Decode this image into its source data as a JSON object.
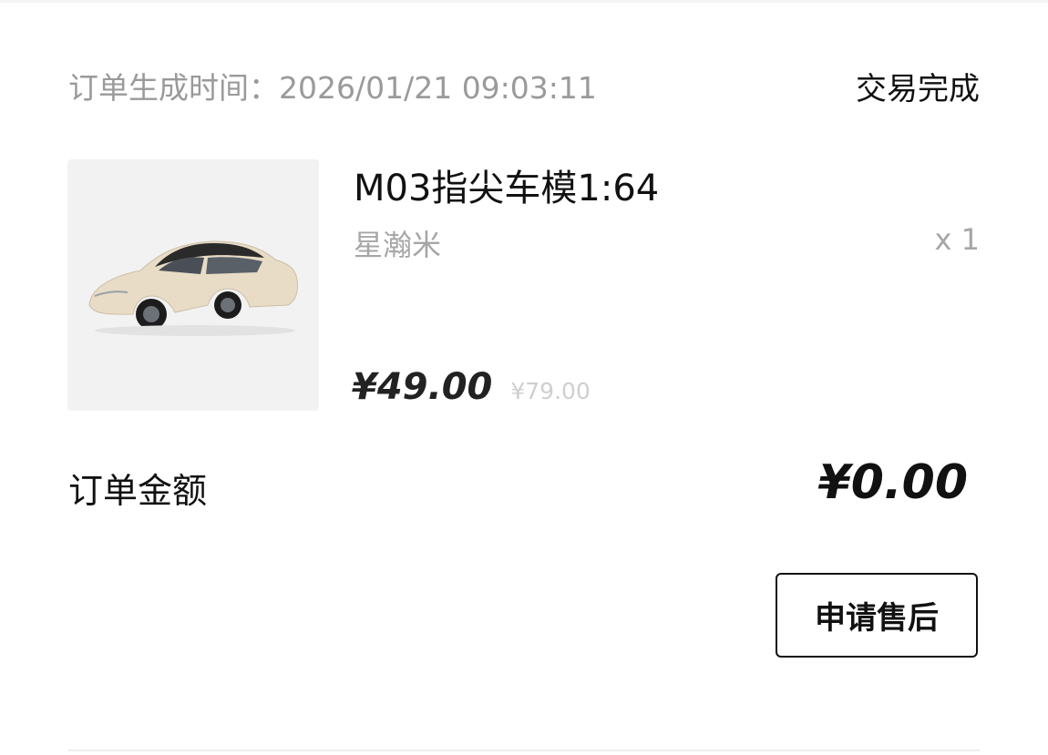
{
  "order": {
    "time_label": "订单生成时间：",
    "time_value": "2026/01/21 09:03:11",
    "status": "交易完成"
  },
  "product": {
    "image_icon": "car-model-image",
    "name": "M03指尖车模1:64",
    "brand": "星瀚米",
    "quantity": "x 1",
    "price_current": "¥49.00",
    "price_original": "¥79.00"
  },
  "summary": {
    "total_label": "订单金额",
    "total_value": "¥0.00"
  },
  "actions": {
    "after_sale_label": "申请售后"
  },
  "colors": {
    "muted_text": "#9a9a9a",
    "primary_text": "#111111",
    "strike_text": "#cfcfcf",
    "thumb_bg": "#f2f2f2"
  }
}
